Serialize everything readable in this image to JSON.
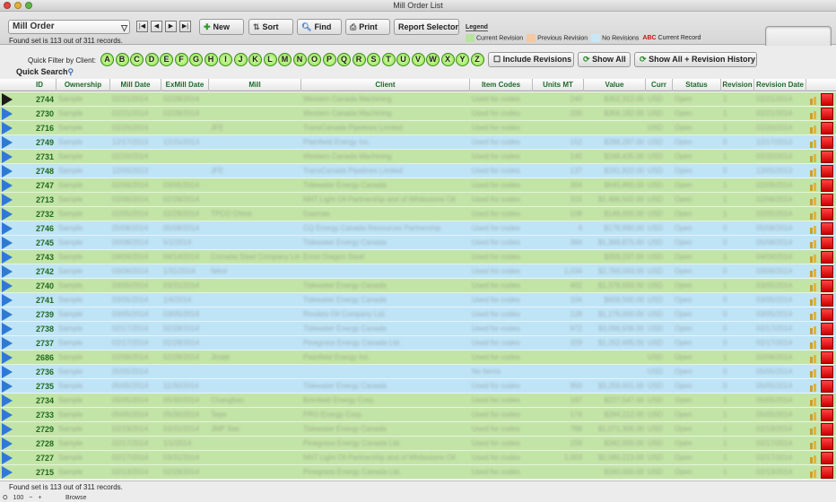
{
  "window": {
    "title": "Mill Order List"
  },
  "toolbar": {
    "layout": "Mill Order",
    "nav": [
      "|◀",
      "◀",
      "▶",
      "▶|"
    ],
    "new_label": "New",
    "sort_label": "Sort",
    "find_label": "Find",
    "print_label": "Print",
    "report_label": "Report Selector",
    "found_text": "Found set is 113 out of 311 records."
  },
  "legend": {
    "title": "Legend",
    "current": "Current Revision",
    "previous": "Previous Revision",
    "none": "No Revisions",
    "abc": "ABC",
    "record": "Current Record",
    "colors": {
      "current": "#b8e2a0",
      "previous": "#f5c9a0",
      "none": "#c8e8f8",
      "abc": "#cc1111"
    }
  },
  "filter": {
    "label": "Quick Filter by Client:",
    "letters": [
      "A",
      "B",
      "C",
      "D",
      "E",
      "F",
      "G",
      "H",
      "I",
      "J",
      "K",
      "L",
      "M",
      "N",
      "O",
      "P",
      "Q",
      "R",
      "S",
      "T",
      "U",
      "V",
      "W",
      "X",
      "Y",
      "Z"
    ],
    "include_revisions": "Include Revisions",
    "show_all": "Show All",
    "show_all_history": "Show All + Revision History",
    "quick_search": "Quick Search"
  },
  "columns": [
    "ID",
    "Ownership",
    "Mill Date",
    "ExMill Date",
    "Mill",
    "Client",
    "Item Codes",
    "Units MT",
    "Value",
    "Curr",
    "Status",
    "Revision",
    "Revision Date"
  ],
  "rows": [
    {
      "id": "2744",
      "color": "green",
      "blur": [
        "Sample",
        "02/21/2014",
        "02/28/2014",
        "",
        "Western Canada Machining",
        "Used for codes",
        "240",
        "$352,312.00",
        "USD",
        "Open",
        "1",
        "02/21/2014"
      ]
    },
    {
      "id": "2730",
      "color": "green",
      "blur": [
        "Sample",
        "02/21/2014",
        "02/28/2014",
        "",
        "Western Canada Machining",
        "Used for codes",
        "200",
        "$356,182.00",
        "USD",
        "Open",
        "1",
        "02/21/2014"
      ]
    },
    {
      "id": "2716",
      "color": "green",
      "blur": [
        "Sample",
        "02/20/2014",
        "",
        "JFE",
        "TransCanada Pipelines Limited",
        "Used for codes",
        "",
        "",
        "USD",
        "Open",
        "1",
        "02/20/2014"
      ]
    },
    {
      "id": "2749",
      "color": "blue",
      "blur": [
        "Sample",
        "12/17/2013",
        "12/31/2013",
        "",
        "Plainfield Energy Inc.",
        "Used for codes",
        "152",
        "$288,297.00",
        "USD",
        "Open",
        "0",
        "12/17/2013"
      ]
    },
    {
      "id": "2731",
      "color": "green",
      "blur": [
        "Sample",
        "02/20/2014",
        "",
        "",
        "Western Canada Machining",
        "Used for codes",
        "140",
        "$248,435.00",
        "USD",
        "Open",
        "1",
        "02/20/2014"
      ]
    },
    {
      "id": "2748",
      "color": "blue",
      "blur": [
        "Sample",
        "12/05/2013",
        "",
        "JFE",
        "TransCanada Pipelines Limited",
        "Used for codes",
        "137",
        "$161,822.00",
        "USD",
        "Open",
        "0",
        "12/05/2013"
      ]
    },
    {
      "id": "2747",
      "color": "green",
      "blur": [
        "Sample",
        "02/06/2014",
        "03/05/2014",
        "",
        "Tidewater Energy Canada",
        "Used for codes",
        "304",
        "$640,860.00",
        "USD",
        "Open",
        "1",
        "02/06/2014"
      ]
    },
    {
      "id": "2713",
      "color": "green",
      "blur": [
        "Sample",
        "02/06/2014",
        "02/28/2014",
        "",
        "NNT Light Oil Partnership and of Whitestone Oil",
        "Used for codes",
        "315",
        "$1,486,502.00",
        "USD",
        "Open",
        "1",
        "02/06/2014"
      ]
    },
    {
      "id": "2732",
      "color": "green",
      "blur": [
        "Sample",
        "02/05/2014",
        "02/28/2014",
        "TPCO China",
        "Gasmax",
        "Used for codes",
        "108",
        "$148,000.00",
        "USD",
        "Open",
        "1",
        "02/05/2014"
      ]
    },
    {
      "id": "2746",
      "color": "blue",
      "blur": [
        "Sample",
        "05/08/2014",
        "05/08/2014",
        "",
        "CQ Energy Canada Resources Partnership",
        "Used for codes",
        "4",
        "$178,890.00",
        "USD",
        "Open",
        "0",
        "05/08/2014"
      ]
    },
    {
      "id": "2745",
      "color": "blue",
      "blur": [
        "Sample",
        "05/08/2014",
        "5/1/2014",
        "",
        "Tidewater Energy Canada",
        "Used for codes",
        "384",
        "$1,369,875.00",
        "USD",
        "Open",
        "0",
        "05/08/2014"
      ]
    },
    {
      "id": "2743",
      "color": "green",
      "blur": [
        "Sample",
        "04/04/2014",
        "04/14/2014",
        "Cornelia Steel Company Limited",
        "Ernst Oregon Steel",
        "Used for codes",
        "",
        "$359,237.00",
        "USD",
        "Open",
        "1",
        "04/04/2014"
      ]
    },
    {
      "id": "2742",
      "color": "blue",
      "blur": [
        "Sample",
        "03/06/2014",
        "1/31/2014",
        "Nikol",
        "",
        "Used for codes",
        "1,034",
        "$2,769,093.00",
        "USD",
        "Open",
        "0",
        "03/06/2014"
      ]
    },
    {
      "id": "2740",
      "color": "green",
      "blur": [
        "Sample",
        "03/05/2014",
        "03/31/2014",
        "",
        "Tidewater Energy Canada",
        "Used for codes",
        "402",
        "$1,378,693.00",
        "USD",
        "Open",
        "1",
        "03/05/2014"
      ]
    },
    {
      "id": "2741",
      "color": "blue",
      "blur": [
        "Sample",
        "03/05/2014",
        "1/4/2014",
        "",
        "Tidewater Energy Canada",
        "Used for codes",
        "104",
        "$658,500.00",
        "USD",
        "Open",
        "0",
        "03/05/2014"
      ]
    },
    {
      "id": "2739",
      "color": "blue",
      "blur": [
        "Sample",
        "03/05/2014",
        "03/05/2014",
        "",
        "Rivulets Oil Company Ltd.",
        "Used for codes",
        "128",
        "$1,176,000.00",
        "USD",
        "Open",
        "0",
        "03/05/2014"
      ]
    },
    {
      "id": "2738",
      "color": "blue",
      "blur": [
        "Sample",
        "02/17/2014",
        "02/28/2014",
        "",
        "Tidewater Energy Canada",
        "Used for codes",
        "972",
        "$3,096,938.00",
        "USD",
        "Open",
        "0",
        "02/17/2014"
      ]
    },
    {
      "id": "2737",
      "color": "blue",
      "blur": [
        "Sample",
        "02/17/2014",
        "02/28/2014",
        "",
        "Pinegrass Energy Canada Ltd.",
        "Used for codes",
        "329",
        "$1,252,695.00",
        "USD",
        "Open",
        "0",
        "02/17/2014"
      ]
    },
    {
      "id": "2686",
      "color": "green",
      "blur": [
        "Sample",
        "02/06/2014",
        "02/28/2014",
        "Jindal",
        "Plainfield Energy Inc.",
        "Used for codes",
        "",
        "",
        "USD",
        "Open",
        "1",
        "02/06/2014"
      ]
    },
    {
      "id": "2736",
      "color": "blue",
      "blur": [
        "Sample",
        "05/05/2014",
        "",
        "",
        "",
        "No Items",
        "",
        "",
        "USD",
        "Open",
        "0",
        "05/05/2014"
      ]
    },
    {
      "id": "2735",
      "color": "blue",
      "blur": [
        "Sample",
        "05/05/2014",
        "11/30/2014",
        "",
        "Tidewater Energy Canada",
        "Used for codes",
        "950",
        "$3,259,001.00",
        "USD",
        "Open",
        "0",
        "05/05/2014"
      ]
    },
    {
      "id": "2734",
      "color": "green",
      "blur": [
        "Sample",
        "05/05/2014",
        "05/30/2014",
        "Changbao",
        "Brimfield Energy Corp.",
        "Used for codes",
        "197",
        "$227,547.00",
        "USD",
        "Open",
        "1",
        "05/05/2014"
      ]
    },
    {
      "id": "2733",
      "color": "green",
      "blur": [
        "Sample",
        "05/05/2014",
        "05/30/2014",
        "Tepe",
        "PRO Energy Corp.",
        "Used for codes",
        "174",
        "$284,212.00",
        "USD",
        "Open",
        "1",
        "05/05/2014"
      ]
    },
    {
      "id": "2729",
      "color": "green",
      "blur": [
        "Sample",
        "02/19/2014",
        "03/31/2014",
        "JMP Sier",
        "Tidewater Energy Canada",
        "Used for codes",
        "788",
        "$1,071,306.00",
        "USD",
        "Open",
        "1",
        "02/19/2014"
      ]
    },
    {
      "id": "2728",
      "color": "green",
      "blur": [
        "Sample",
        "02/17/2014",
        "1/1/2014",
        "",
        "Pinegrass Energy Canada Ltd.",
        "Used for codes",
        "159",
        "$342,000.00",
        "USD",
        "Open",
        "1",
        "02/17/2014"
      ]
    },
    {
      "id": "2727",
      "color": "green",
      "blur": [
        "Sample",
        "02/17/2014",
        "03/31/2014",
        "",
        "NNT Light Oil Partnership and of Whitestone Oil",
        "Used for codes",
        "1,003",
        "$2,080,213.00",
        "USD",
        "Open",
        "1",
        "02/17/2014"
      ]
    },
    {
      "id": "2715",
      "color": "green",
      "blur": [
        "Sample",
        "02/13/2014",
        "02/28/2014",
        "",
        "Pinegrass Energy Canada Ltd.",
        "Used for codes",
        "",
        "$160,000.00",
        "USD",
        "Open",
        "1",
        "02/13/2014"
      ]
    }
  ],
  "status": {
    "found_text": "Found set is 113 out of 311 records.",
    "zoom": "100",
    "mode": "Browse"
  }
}
